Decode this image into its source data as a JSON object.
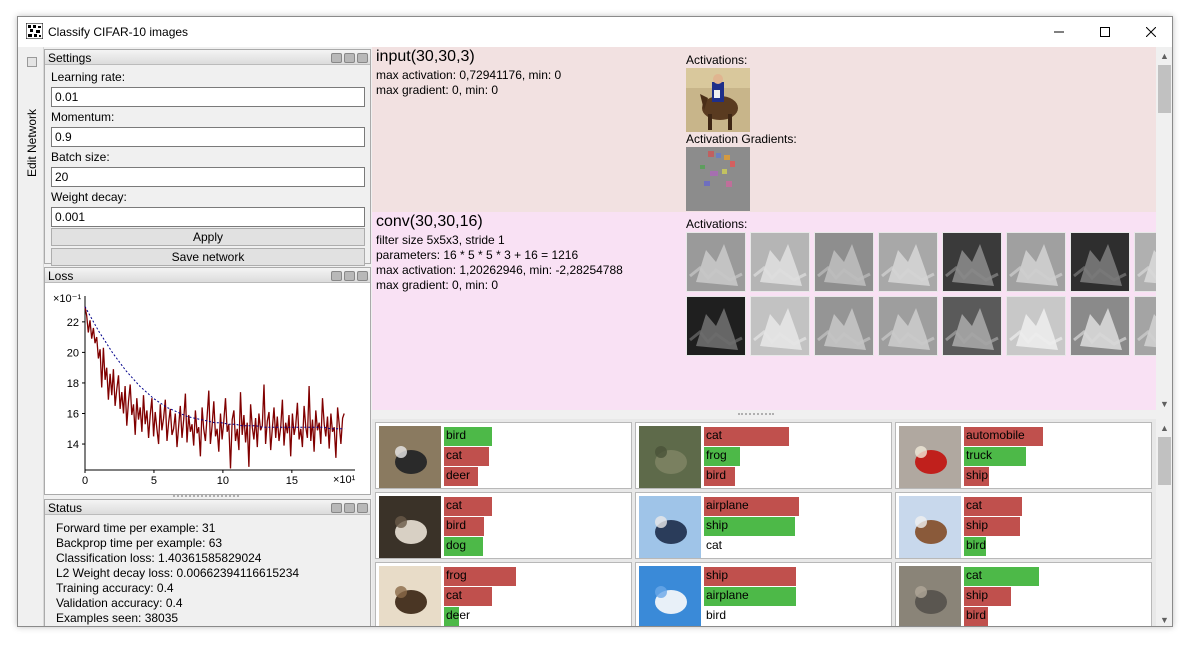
{
  "window": {
    "title": "Classify CIFAR-10 images"
  },
  "dock": {
    "tab_label": "Edit Network"
  },
  "settings": {
    "title": "Settings",
    "learning_rate_label": "Learning rate:",
    "learning_rate": "0.01",
    "momentum_label": "Momentum:",
    "momentum": "0.9",
    "batch_size_label": "Batch size:",
    "batch_size": "20",
    "weight_decay_label": "Weight decay:",
    "weight_decay": "0.001",
    "apply_label": "Apply",
    "save_label": "Save network"
  },
  "loss": {
    "title": "Loss",
    "chart_data": {
      "type": "line",
      "title": "",
      "y_multiplier_label": "×10⁻¹",
      "x_multiplier_label": "×10¹",
      "xlim": [
        0,
        19
      ],
      "ylim": [
        12.3,
        23.3
      ],
      "x_ticks": [
        0,
        5,
        10,
        15
      ],
      "y_ticks": [
        14,
        16,
        18,
        20,
        22
      ],
      "series": [
        {
          "color": "#800000",
          "values": [
            23.0,
            22.4,
            21.3,
            22.1,
            20.9,
            21.6,
            20.6,
            21.0,
            19.6,
            20.2,
            17.7,
            20.3,
            18.2,
            19.0,
            16.9,
            18.6,
            17.2,
            18.9,
            16.5,
            17.6,
            18.5,
            16.3,
            17.4,
            16.0,
            17.8,
            15.2,
            16.8,
            17.9,
            15.9,
            16.6,
            14.6,
            17.0,
            15.6,
            16.4,
            14.8,
            17.2,
            15.3,
            16.2,
            14.4,
            15.9,
            17.0,
            14.5,
            16.1,
            15.0,
            14.0,
            16.6,
            14.9,
            15.7,
            16.9,
            14.2,
            15.4,
            16.3,
            14.6,
            15.0,
            16.0,
            13.8,
            15.2,
            16.5,
            14.4,
            15.6,
            17.3,
            14.1,
            15.9,
            14.8,
            15.3,
            13.9,
            16.2,
            14.7,
            15.1,
            13.2,
            16.4,
            15.0,
            14.2,
            15.8,
            17.5,
            14.0,
            15.2,
            16.8,
            14.5,
            15.0,
            13.5,
            16.0,
            14.3,
            15.5,
            17.0,
            14.8,
            15.3,
            12.4,
            15.6,
            16.2,
            14.2,
            15.0,
            13.6,
            17.4,
            14.6,
            15.9,
            14.1,
            15.4,
            12.5,
            16.6,
            15.1,
            14.3,
            15.7,
            13.8,
            16.0,
            14.9,
            15.2,
            17.9,
            14.0,
            15.5,
            16.1,
            13.6,
            15.0,
            16.4,
            14.4,
            15.8,
            14.2,
            15.1,
            16.9,
            13.9,
            15.4,
            14.7,
            15.9,
            13.2,
            16.0,
            14.6,
            15.2,
            16.7,
            14.3,
            15.0,
            13.8,
            16.5,
            15.1,
            14.4,
            17.8,
            14.2,
            15.6,
            13.5,
            16.2,
            14.9,
            15.4,
            14.0,
            17.0,
            15.3,
            14.5,
            15.8,
            13.7,
            16.0,
            14.8,
            15.1,
            13.1,
            16.4,
            15.3,
            14.0,
            15.7,
            16.0
          ]
        },
        {
          "style": "dotted",
          "color": "#00008b",
          "values": [
            23.0,
            22.2,
            21.4,
            20.7,
            20.0,
            19.4,
            18.8,
            18.3,
            17.8,
            17.4,
            17.0,
            16.7,
            16.4,
            16.2,
            16.0,
            15.8,
            15.7,
            15.6,
            15.5,
            15.4,
            15.4,
            15.3,
            15.3,
            15.2,
            15.2,
            15.2,
            15.1,
            15.1,
            15.1,
            15.1,
            15.1,
            15.1,
            15.1,
            15.1,
            15.1,
            15.1,
            15.0,
            15.0,
            15.0
          ]
        }
      ]
    }
  },
  "status": {
    "title": "Status",
    "lines": [
      "Forward time per example: 31",
      "Backprop time per example: 63",
      "Classification loss: 1.40361585829024",
      "L2 Weight decay loss: 0.00662394116615234",
      "Training accuracy: 0.4",
      "Validation accuracy: 0.4",
      "Examples seen: 38035"
    ]
  },
  "layers": [
    {
      "title": "input(30,30,3)",
      "info": [
        "max activation: 0,72941176, min: 0",
        "max gradient: 0, min: 0"
      ],
      "activations_label": "Activations:",
      "gradients_label": "Activation Gradients:",
      "bg": "#f2e1e1"
    },
    {
      "title": "conv(30,30,16)",
      "info": [
        "filter size 5x5x3, stride 1",
        "parameters: 16 * 5 * 5 * 3 + 16 = 1216",
        "max activation: 1,20262946, min: -2,28254788",
        "max gradient: 0, min: 0"
      ],
      "activations_label": "Activations:",
      "bg": "#f9e1f4"
    }
  ],
  "predictions": [
    {
      "image": "bird-on-rock",
      "bars": [
        {
          "label": "bird",
          "value": 0.44,
          "color": "green"
        },
        {
          "label": "cat",
          "value": 0.41,
          "color": "red"
        },
        {
          "label": "deer",
          "value": 0.31,
          "color": "red"
        }
      ]
    },
    {
      "image": "frog",
      "bars": [
        {
          "label": "cat",
          "value": 0.77,
          "color": "red"
        },
        {
          "label": "frog",
          "value": 0.33,
          "color": "green"
        },
        {
          "label": "bird",
          "value": 0.28,
          "color": "red"
        }
      ]
    },
    {
      "image": "fire-truck",
      "bars": [
        {
          "label": "automobile",
          "value": 0.72,
          "color": "red"
        },
        {
          "label": "truck",
          "value": 0.56,
          "color": "green"
        },
        {
          "label": "ship",
          "value": 0.23,
          "color": "red"
        }
      ]
    },
    {
      "image": "cat-dark",
      "bars": [
        {
          "label": "cat",
          "value": 0.44,
          "color": "red"
        },
        {
          "label": "bird",
          "value": 0.36,
          "color": "red"
        },
        {
          "label": "dog",
          "value": 0.35,
          "color": "green"
        }
      ]
    },
    {
      "image": "ship-sea",
      "bars": [
        {
          "label": "airplane",
          "value": 0.86,
          "color": "red"
        },
        {
          "label": "ship",
          "value": 0.83,
          "color": "green"
        },
        {
          "label": "cat",
          "value": 0.0,
          "color": "red"
        }
      ]
    },
    {
      "image": "small-bird",
      "bars": [
        {
          "label": "cat",
          "value": 0.53,
          "color": "red"
        },
        {
          "label": "ship",
          "value": 0.51,
          "color": "red"
        },
        {
          "label": "bird",
          "value": 0.2,
          "color": "green"
        }
      ]
    },
    {
      "image": "deer",
      "bars": [
        {
          "label": "frog",
          "value": 0.65,
          "color": "red"
        },
        {
          "label": "cat",
          "value": 0.44,
          "color": "red"
        },
        {
          "label": "deer",
          "value": 0.14,
          "color": "green"
        }
      ]
    },
    {
      "image": "airplane-sky",
      "bars": [
        {
          "label": "ship",
          "value": 0.84,
          "color": "red"
        },
        {
          "label": "airplane",
          "value": 0.84,
          "color": "green"
        },
        {
          "label": "bird",
          "value": 0.0,
          "color": "red"
        }
      ]
    },
    {
      "image": "cat-grey",
      "bars": [
        {
          "label": "cat",
          "value": 0.68,
          "color": "green"
        },
        {
          "label": "ship",
          "value": 0.43,
          "color": "red"
        },
        {
          "label": "bird",
          "value": 0.22,
          "color": "red"
        }
      ]
    }
  ]
}
